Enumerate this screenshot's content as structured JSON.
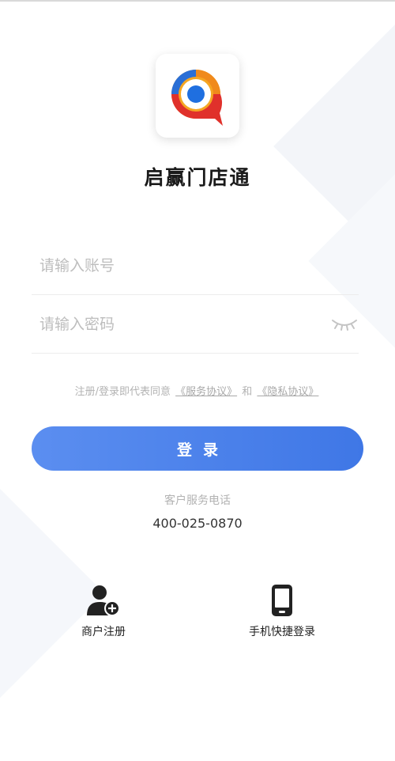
{
  "app": {
    "title": "启赢门店通"
  },
  "login_form": {
    "account_placeholder": "请输入账号",
    "password_placeholder": "请输入密码",
    "agreement_prefix": "注册/登录即代表同意",
    "service_agreement": "《服务协议》",
    "agreement_and": "和",
    "privacy_agreement": "《隐私协议》",
    "login_button": "登录"
  },
  "customer_service": {
    "label": "客户服务电话",
    "phone": "400-025-0870"
  },
  "bottom_actions": [
    {
      "label": "商户注册",
      "icon": "user-add-icon"
    },
    {
      "label": "手机快捷登录",
      "icon": "mobile-phone-icon"
    }
  ],
  "colors": {
    "primary_gradient_start": "#5b8ef0",
    "primary_gradient_end": "#3f77e6",
    "logo_red": "#e0312b",
    "logo_orange": "#f5a623",
    "logo_blue": "#1f6fe0"
  }
}
